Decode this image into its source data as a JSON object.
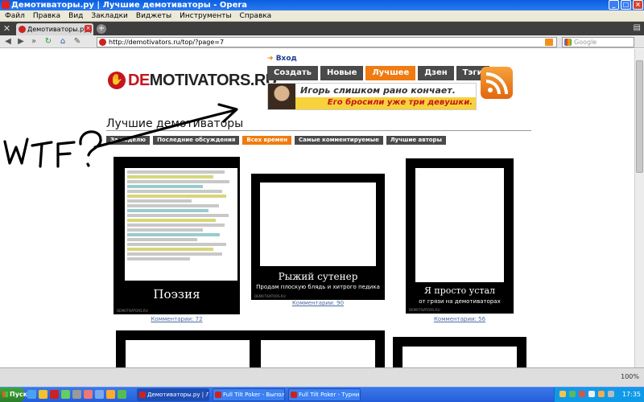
{
  "window": {
    "title": "Демотиваторы.ру | Лучшие демотиваторы - Opera"
  },
  "menu": [
    "Файл",
    "Правка",
    "Вид",
    "Закладки",
    "Виджеты",
    "Инструменты",
    "Справка"
  ],
  "tabs": [
    {
      "label": "Демотиваторы.ру | Лу..."
    }
  ],
  "address_bar": {
    "url": "http://demotivators.ru/top/?page=7",
    "search_placeholder": "Google"
  },
  "site": {
    "logo_prefix": "DE",
    "logo_rest": "MOTIVATORS.RU",
    "logo_icon": "stop-hand-icon",
    "login": "Вход",
    "nav": [
      {
        "label": "Создать",
        "active": false
      },
      {
        "label": "Новые",
        "active": false
      },
      {
        "label": "Лучшее",
        "active": true
      },
      {
        "label": "Дзен",
        "active": false
      },
      {
        "label": "Тэги",
        "active": false
      }
    ],
    "promo_line1": "Игорь слишком рано кончает.",
    "promo_line2": "Его бросили уже три девушки.",
    "heading": "Лучшие демотиваторы",
    "sub_nav": [
      {
        "label": "За неделю",
        "active": false
      },
      {
        "label": "Последние обсуждения",
        "active": false
      },
      {
        "label": "Всех времен",
        "active": true
      },
      {
        "label": "Самые комментируемые",
        "active": false
      },
      {
        "label": "Лучшие авторы",
        "active": false
      }
    ],
    "scrawl": "WTF?"
  },
  "posters": [
    {
      "title": "Поэзия",
      "subtitle": "",
      "comments": "Комментарии: 72",
      "watermark": "DEMOTIVATORS.RU"
    },
    {
      "title": "Рыжий сутенер",
      "subtitle": "Продам плоскую блядь и хитрого педика",
      "comments": "Комментарии: 90",
      "watermark": "DEMOTIVATORS.RU"
    },
    {
      "title": "Я просто устал",
      "subtitle": "от грязи на демотиваторах",
      "comments": "Комментарии: 56",
      "watermark": "DEMOTIVATORS.RU"
    }
  ],
  "status": {
    "zoom": "100%"
  },
  "taskbar": {
    "start": "Пуск",
    "items": [
      {
        "label": "Демотиваторы.ру | Лу...",
        "active": true
      },
      {
        "label": "Full Tilt Poker - Выполне...",
        "active": false
      },
      {
        "label": "Full Tilt Poker - Турнир 1...",
        "active": false
      }
    ],
    "clock": "17:35"
  },
  "colors": {
    "accent": "#f07b10",
    "brand_red": "#c4161c",
    "nav_dark": "#4a4a4a",
    "promo_yellow": "#f7d23a",
    "titlebar_blue": "#0b5fe0"
  }
}
